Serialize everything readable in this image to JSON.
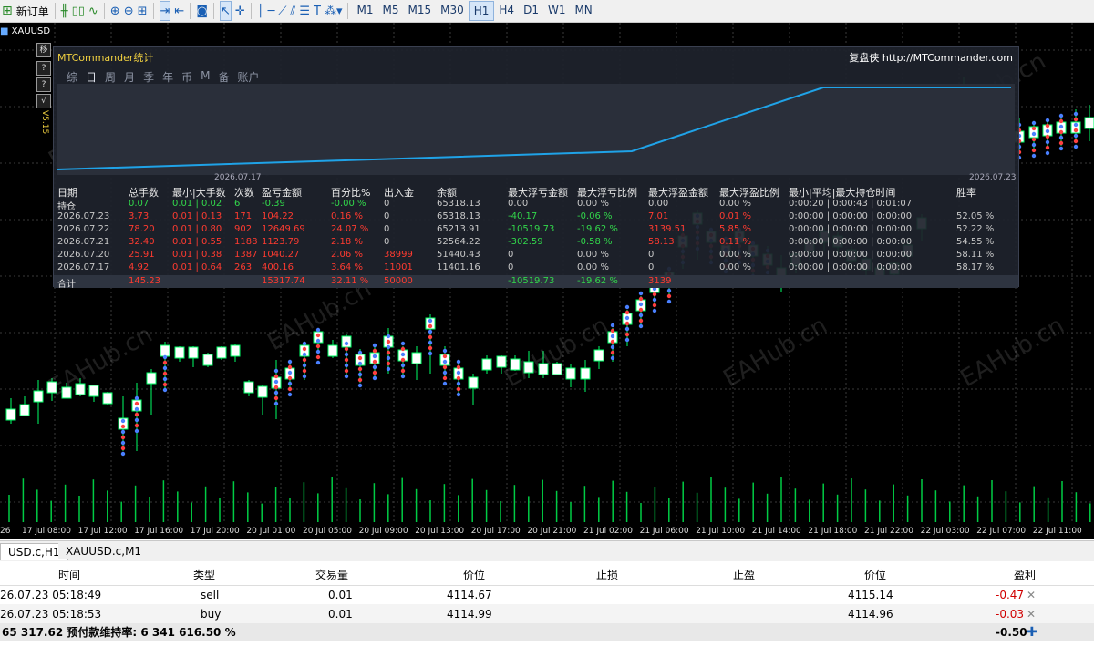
{
  "toolbar": {
    "new_order": "新订单",
    "timeframes": [
      "M1",
      "M5",
      "M15",
      "M30",
      "H1",
      "H4",
      "D1",
      "W1",
      "MN"
    ],
    "active_timeframe": "H1"
  },
  "chart": {
    "symbol_label": "XAUUSD",
    "version": "V5.15",
    "side_buttons": [
      "移",
      "?",
      "?",
      "√"
    ],
    "time_labels": [
      "26",
      "17 Jul 08:00",
      "17 Jul 12:00",
      "17 Jul 16:00",
      "17 Jul 20:00",
      "20 Jul 01:00",
      "20 Jul 05:00",
      "20 Jul 09:00",
      "20 Jul 13:00",
      "20 Jul 17:00",
      "20 Jul 21:00",
      "21 Jul 02:00",
      "21 Jul 06:00",
      "21 Jul 10:00",
      "21 Jul 14:00",
      "21 Jul 18:00",
      "21 Jul 22:00",
      "22 Jul 03:00",
      "22 Jul 07:00",
      "22 Jul 11:00"
    ],
    "watermark": "EAHub.cn"
  },
  "stats": {
    "title": "MTCommander统计",
    "brand": "复盘侠 http://MTCommander.com",
    "tabs": [
      "综",
      "日",
      "周",
      "月",
      "季",
      "年",
      "币",
      "M",
      "备",
      "账户"
    ],
    "active_tab": "日",
    "date_left": "2026.07.17",
    "date_right": "2026.07.23",
    "headers": [
      "日期",
      "总手数",
      "最小|大手数",
      "次数",
      "盈亏金额",
      "百分比%",
      "出入金",
      "余额",
      "最大浮亏金额",
      "最大浮亏比例",
      "最大浮盈金额",
      "最大浮盈比例",
      "最小|平均|最大持仓时间",
      "胜率"
    ],
    "position_row": [
      "持仓",
      "0.07",
      "0.01 | 0.02",
      "6",
      "-0.39",
      "-0.00 %",
      "0",
      "65318.13",
      "0.00",
      "0.00 %",
      "0.00",
      "0.00 %",
      "0:00:20 | 0:00:43 | 0:01:07",
      ""
    ],
    "rows": [
      [
        "2026.07.23",
        "3.73",
        "0.01 | 0.13",
        "171",
        "104.22",
        "0.16 %",
        "0",
        "65318.13",
        "-40.17",
        "-0.06 %",
        "7.01",
        "0.01 %",
        "0:00:00 | 0:00:00 | 0:00:00",
        "52.05 %"
      ],
      [
        "2026.07.22",
        "78.20",
        "0.01 | 0.80",
        "902",
        "12649.69",
        "24.07 %",
        "0",
        "65213.91",
        "-10519.73",
        "-19.62 %",
        "3139.51",
        "5.85 %",
        "0:00:00 | 0:00:00 | 0:00:00",
        "52.22 %"
      ],
      [
        "2026.07.21",
        "32.40",
        "0.01 | 0.55",
        "1188",
        "1123.79",
        "2.18 %",
        "0",
        "52564.22",
        "-302.59",
        "-0.58 %",
        "58.13",
        "0.11 %",
        "0:00:00 | 0:00:00 | 0:00:00",
        "54.55 %"
      ],
      [
        "2026.07.20",
        "25.91",
        "0.01 | 0.38",
        "1387",
        "1040.27",
        "2.06 %",
        "38999",
        "51440.43",
        "0",
        "0.00 %",
        "0",
        "0.00 %",
        "0:00:00 | 0:00:00 | 0:00:00",
        "58.11 %"
      ],
      [
        "2026.07.17",
        "4.92",
        "0.01 | 0.64",
        "263",
        "400.16",
        "3.64 %",
        "11001",
        "11401.16",
        "0",
        "0.00 %",
        "0",
        "0.00 %",
        "0:00:00 | 0:00:00 | 0:00:00",
        "58.17 %"
      ]
    ],
    "total_row": [
      "合计",
      "145.23",
      "",
      "",
      "15317.74",
      "32.11 %",
      "50000",
      "",
      "-10519.73",
      "-19.62 %",
      "3139",
      "",
      "",
      ""
    ]
  },
  "bottom_tabs": [
    "USD.c,H1",
    "XAUUSD.c,M1"
  ],
  "orders": {
    "headers": [
      "时间",
      "类型",
      "交易量",
      "价位",
      "止损",
      "止盈",
      "价位",
      "盈利"
    ],
    "rows": [
      [
        "26.07.23 05:18:49",
        "sell",
        "0.01",
        "4114.67",
        "",
        "",
        "4115.14",
        "-0.47"
      ],
      [
        "26.07.23 05:18:53",
        "buy",
        "0.01",
        "4114.99",
        "",
        "",
        "4114.96",
        "-0.03"
      ]
    ],
    "summary_left": "65 317.62  预付款维持率: 6 341 616.50 %",
    "summary_right": "-0.50"
  }
}
